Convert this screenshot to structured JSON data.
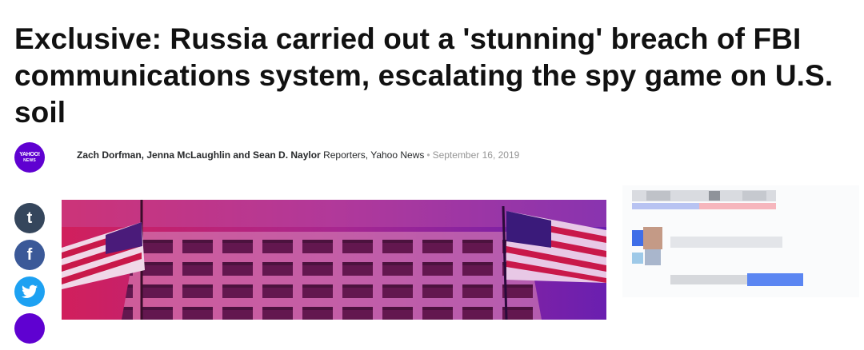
{
  "article": {
    "headline": "Exclusive: Russia carried out a 'stunning' breach of FBI communications system, escalating the spy game on U.S. soil"
  },
  "byline": {
    "logo_line1": "YAHOO!",
    "logo_line2": "NEWS",
    "authors": "Zach Dorfman, Jenna McLaughlin and Sean D. Naylor",
    "role": "Reporters, Yahoo News",
    "separator": "•",
    "date": "September 16, 2019"
  },
  "share": {
    "tumblr_glyph": "t",
    "facebook_glyph": "f",
    "icons": [
      "tumblr-icon",
      "facebook-icon",
      "twitter-icon",
      "more-share-icon"
    ],
    "colors": {
      "tumblr": "#35465c",
      "facebook": "#3b5998",
      "twitter": "#1da1f2",
      "more": "#5f01d1"
    }
  },
  "colors": {
    "brand": "#5f01d1",
    "hero_magenta": "#c0206a",
    "hero_violet": "#6a1fb0"
  }
}
